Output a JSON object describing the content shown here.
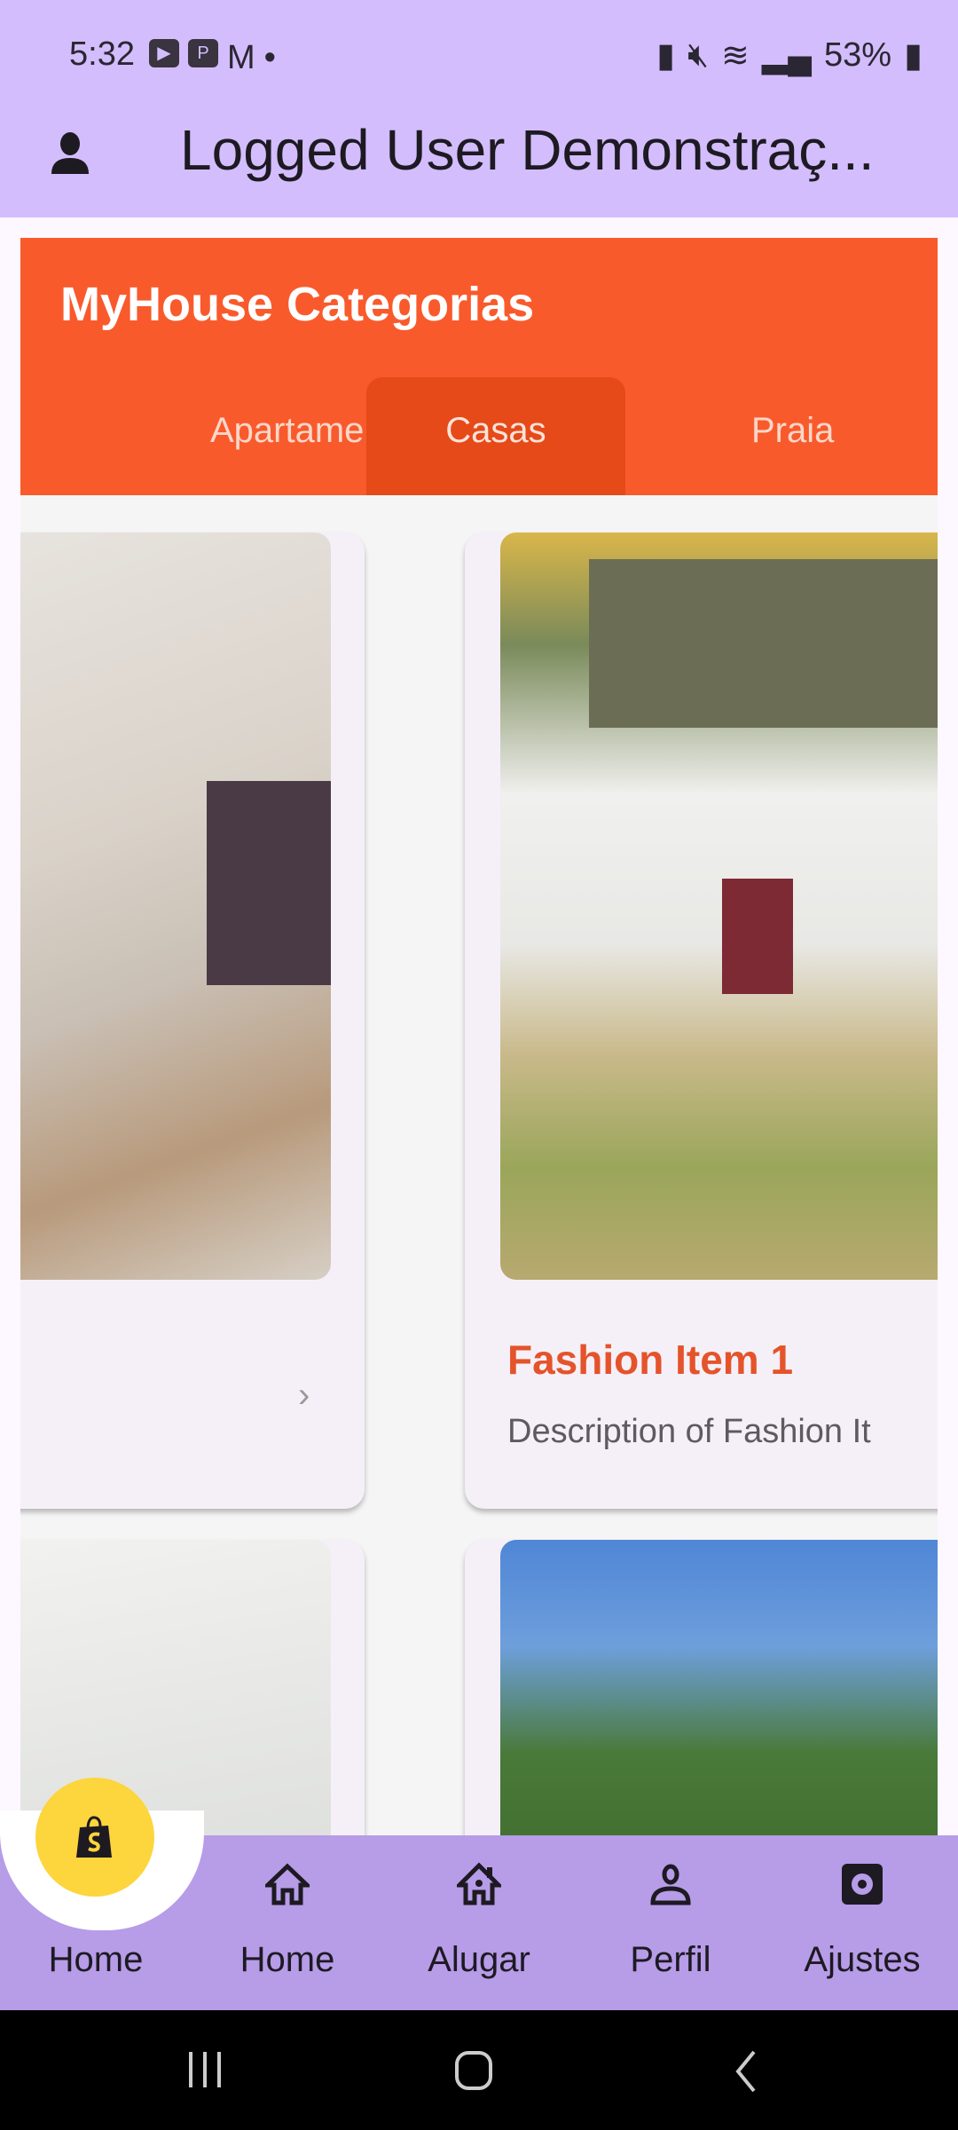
{
  "status_bar": {
    "time": "5:32",
    "battery": "53%"
  },
  "app_bar": {
    "title": "Logged User Demonstraç...",
    "icon": "person-icon"
  },
  "header": {
    "title": "MyHouse Categorias",
    "tabs": [
      {
        "label": "Apartamentos"
      },
      {
        "label": "Casas",
        "selected": true
      },
      {
        "label": "Praia"
      }
    ],
    "color": "#F95A2C"
  },
  "cards": [
    {
      "title": "Fashion Item 1",
      "description": "Description of Fashion It"
    }
  ],
  "bottom_nav": {
    "fab_icon": "shopify-bag-icon",
    "items": [
      {
        "label": "Home",
        "icon": "shopify-icon"
      },
      {
        "label": "Home",
        "icon": "home-icon"
      },
      {
        "label": "Alugar",
        "icon": "house-icon"
      },
      {
        "label": "Perfil",
        "icon": "person-icon"
      },
      {
        "label": "Ajustes",
        "icon": "gear-icon"
      }
    ]
  }
}
